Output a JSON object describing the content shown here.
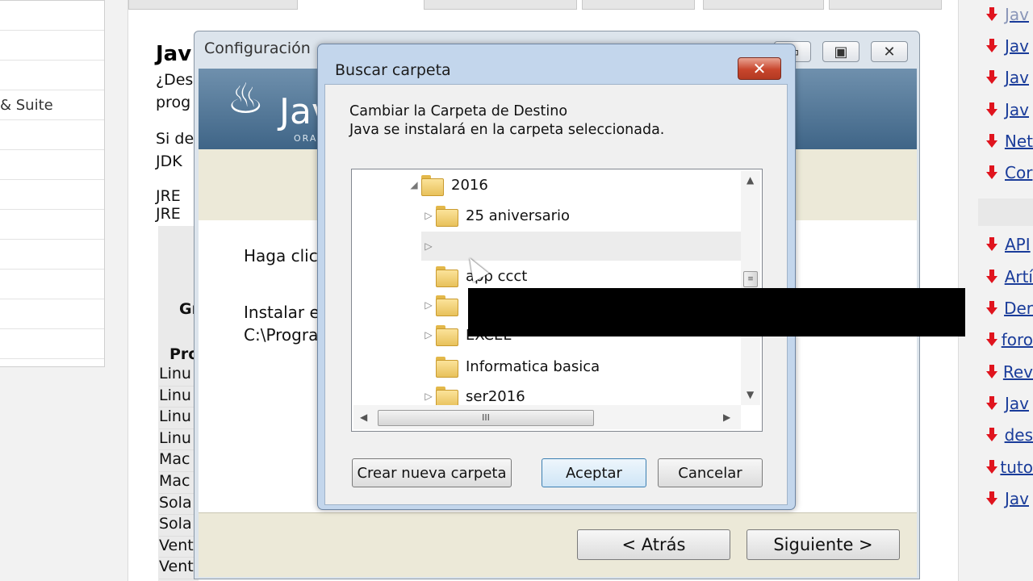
{
  "left_panel": {
    "rows": [
      "",
      "",
      "",
      "& Suite",
      "",
      "",
      "",
      "",
      "",
      "",
      "",
      ""
    ]
  },
  "page": {
    "title": "Jav",
    "line1": "¿Des",
    "line2": "prog",
    "line3": "Si de",
    "line4": "JDK",
    "line5": "JRE",
    "line6": "JRE",
    "gr": "Gr",
    "pro": "Pro",
    "os_rows": [
      "Linu",
      "Linu",
      "Linu",
      "Linu",
      "Mac",
      "Mac",
      "Sola",
      "Sola",
      "Vent",
      "Vent"
    ]
  },
  "right_list": {
    "items": [
      "Jav",
      "Jav",
      "Jav",
      "Jav",
      "Net",
      "Cor",
      "",
      "API",
      "Artí",
      "Der",
      "foro",
      "Rev",
      "Jav",
      "des",
      "tuto",
      "Jav"
    ]
  },
  "installer": {
    "title": "Configuración",
    "logo_text": "Jav",
    "oracle_text": "ORA",
    "haga_clic": "Haga clic",
    "instalar": "Instalar e",
    "path": "C:\\Progra",
    "back_button": "< Atrás",
    "next_button": "Siguiente >"
  },
  "dialog": {
    "title": "Buscar carpeta",
    "close": "✕",
    "instruction1": "Cambiar la Carpeta de Destino",
    "instruction2": "Java se instalará en la carpeta seleccionada.",
    "tree": [
      {
        "label": "2016",
        "expander": "◢"
      },
      {
        "label": "25 aniversario",
        "expander": "▷"
      },
      {
        "label": "",
        "expander": "▷"
      },
      {
        "label": "app ccct",
        "expander": ""
      },
      {
        "label": "",
        "expander": "▷"
      },
      {
        "label": "EXCEL",
        "expander": "▷"
      },
      {
        "label": "Informatica basica",
        "expander": ""
      },
      {
        "label": "ser2016",
        "expander": "▷"
      }
    ],
    "new_folder_button": "Crear nueva carpeta",
    "ok_button": "Aceptar",
    "cancel_button": "Cancelar"
  }
}
